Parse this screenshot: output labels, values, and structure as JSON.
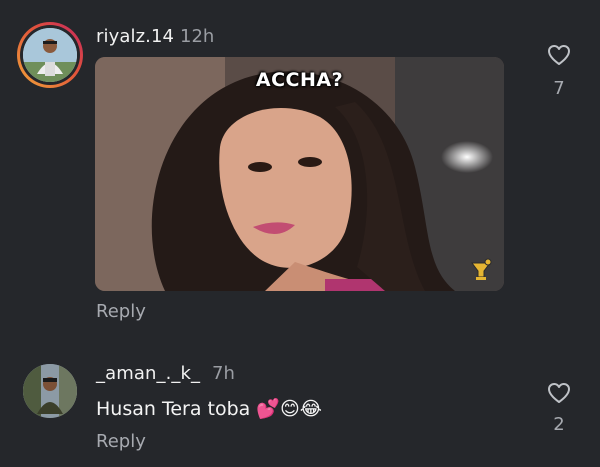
{
  "comments": [
    {
      "username": "riyalz.14",
      "time": "12h",
      "gif_caption": "ACCHA?",
      "reply_label": "Reply",
      "likes": "7"
    },
    {
      "username": "_aman_._k_",
      "time": "7h",
      "text": "Husan Tera toba 💕😊😂",
      "reply_label": "Reply",
      "likes": "2"
    }
  ],
  "icons": {
    "like": "heart-outline-icon",
    "gif_badge": "giphy-sticker-icon"
  },
  "colors": {
    "background": "#25272b",
    "story_ring_start": "#c5255f",
    "story_ring_end": "#f1a63a",
    "muted_text": "#a7aab0"
  }
}
